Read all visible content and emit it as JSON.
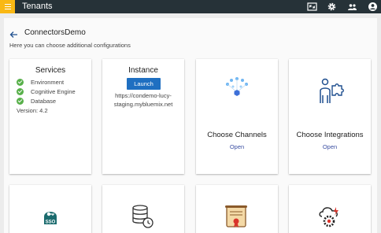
{
  "header": {
    "app_title": "Tenants",
    "bg_color": "#263238",
    "accent": "#f9b814",
    "icons": [
      "fullscreen-icon",
      "gear-icon",
      "people-icon",
      "account-circle-icon"
    ]
  },
  "page": {
    "title": "ConnectorsDemo",
    "subtitle": "Here you can choose additional configurations"
  },
  "services": {
    "title": "Services",
    "items": [
      "Environment",
      "Cognitive Engine",
      "Database"
    ],
    "version": "Version: 4.2"
  },
  "instance": {
    "title": "Instance",
    "launch_label": "Launch",
    "url_line1": "https://condemo-lucy-",
    "url_line2": "staging.mybluemix.net"
  },
  "channels": {
    "title": "Choose Channels",
    "link": "Open"
  },
  "integrations": {
    "title": "Choose Integrations",
    "link": "Open"
  },
  "bottom_cards": {
    "sso_label": "SSO",
    "icons": [
      "sso-key-icon",
      "database-history-icon",
      "certificate-icon",
      "cloud-gear-icon"
    ]
  },
  "colors": {
    "link": "#3b4fa3",
    "button": "#1f6fc1",
    "check": "#58b04a",
    "icon_blue": "#1f4f8f"
  }
}
